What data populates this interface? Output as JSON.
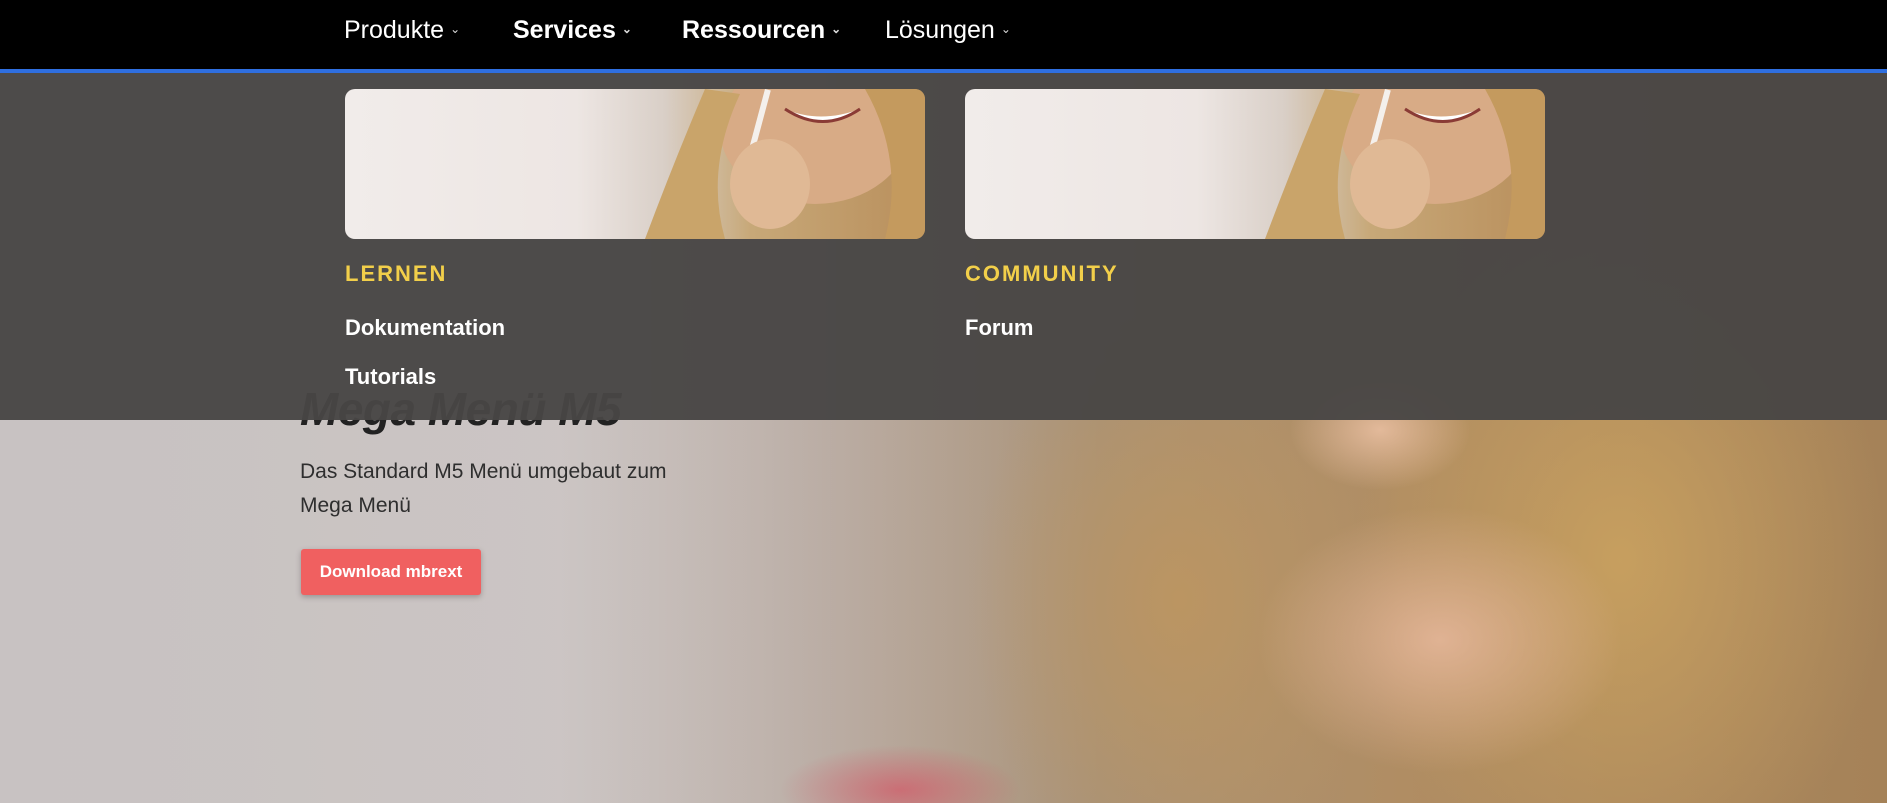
{
  "nav": {
    "items": [
      {
        "label": "Produkte"
      },
      {
        "label": "Services"
      },
      {
        "label": "Ressourcen"
      },
      {
        "label": "Lösungen"
      }
    ],
    "chevron": "⌄",
    "accent_color": "#2f6fe0"
  },
  "mega_menu": {
    "columns": [
      {
        "heading": "LERNEN",
        "links": [
          "Dokumentation",
          "Tutorials"
        ],
        "image_icon": "photo-icon"
      },
      {
        "heading": "COMMUNITY",
        "links": [
          "Forum"
        ],
        "image_icon": "photo-icon"
      }
    ],
    "heading_color": "#f2cf4a"
  },
  "hero": {
    "title": "Mega Menü M5",
    "description": "Das Standard M5 Menü umgebaut zum Mega Menü",
    "button_label": "Download mbrext",
    "button_color": "#f06060"
  }
}
